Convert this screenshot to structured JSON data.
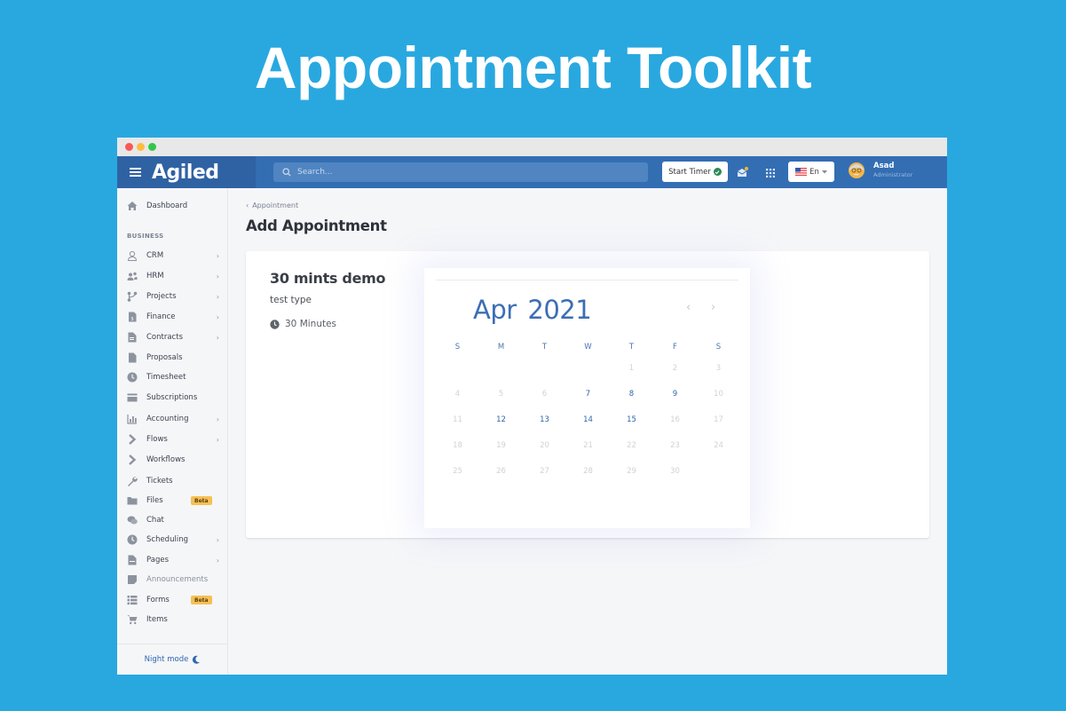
{
  "hero": {
    "title": "Appointment Toolkit"
  },
  "topbar": {
    "logo": "Agiled",
    "search_placeholder": "Search...",
    "start_timer_label": "Start Timer",
    "language": "En",
    "user": {
      "name": "Asad",
      "role": "Administrator"
    }
  },
  "sidebar": {
    "dashboard": "Dashboard",
    "section_business": "BUSINESS",
    "items": [
      {
        "label": "CRM",
        "icon": "user-icon",
        "has_chevron": true
      },
      {
        "label": "HRM",
        "icon": "users-icon",
        "has_chevron": true
      },
      {
        "label": "Projects",
        "icon": "project-branch-icon",
        "has_chevron": true
      },
      {
        "label": "Finance",
        "icon": "invoice-dollar-icon",
        "has_chevron": true
      },
      {
        "label": "Contracts",
        "icon": "contract-icon",
        "has_chevron": true
      },
      {
        "label": "Proposals",
        "icon": "file-icon",
        "has_chevron": false
      },
      {
        "label": "Timesheet",
        "icon": "clock-icon",
        "has_chevron": false
      },
      {
        "label": "Subscriptions",
        "icon": "credit-card-icon",
        "has_chevron": false
      },
      {
        "label": "Accounting",
        "icon": "bar-chart-icon",
        "has_chevron": true
      },
      {
        "label": "Flows",
        "icon": "chevron-right-icon",
        "has_chevron": true
      },
      {
        "label": "Workflows",
        "icon": "chevron-right-icon",
        "has_chevron": false
      },
      {
        "label": "Tickets",
        "icon": "wrench-icon",
        "has_chevron": false
      },
      {
        "label": "Files",
        "icon": "folder-icon",
        "has_chevron": false,
        "badge": "Beta"
      },
      {
        "label": "Chat",
        "icon": "chat-icon",
        "has_chevron": false
      },
      {
        "label": "Scheduling",
        "icon": "clock-icon",
        "has_chevron": true
      },
      {
        "label": "Pages",
        "icon": "page-icon",
        "has_chevron": true
      },
      {
        "label": "Announcements",
        "icon": "note-icon",
        "has_chevron": false
      },
      {
        "label": "Forms",
        "icon": "list-icon",
        "has_chevron": false,
        "badge": "Beta"
      },
      {
        "label": "Items",
        "icon": "cart-icon",
        "has_chevron": false
      }
    ],
    "night_mode": "Night mode"
  },
  "main": {
    "breadcrumb": "Appointment",
    "page_title": "Add Appointment",
    "appointment": {
      "title": "30 mints demo",
      "type": "test type",
      "duration": "30 Minutes"
    },
    "calendar": {
      "month": "Apr",
      "year": "2021",
      "weekdays": [
        "S",
        "M",
        "T",
        "W",
        "T",
        "F",
        "S"
      ],
      "weeks": [
        [
          "",
          "",
          "",
          "",
          "1",
          "2",
          "3"
        ],
        [
          "4",
          "5",
          "6",
          "7",
          "8",
          "9",
          "10"
        ],
        [
          "11",
          "12",
          "13",
          "14",
          "15",
          "16",
          "17"
        ],
        [
          "18",
          "19",
          "20",
          "21",
          "22",
          "23",
          "24"
        ],
        [
          "25",
          "26",
          "27",
          "28",
          "29",
          "30",
          ""
        ]
      ],
      "available_days": [
        "7",
        "8",
        "9",
        "12",
        "13",
        "14",
        "15"
      ]
    }
  },
  "colors": {
    "background": "#29a8e0",
    "topbar": "#336eb3",
    "accent": "#2f64ad",
    "beta_badge": "#f6c055"
  }
}
